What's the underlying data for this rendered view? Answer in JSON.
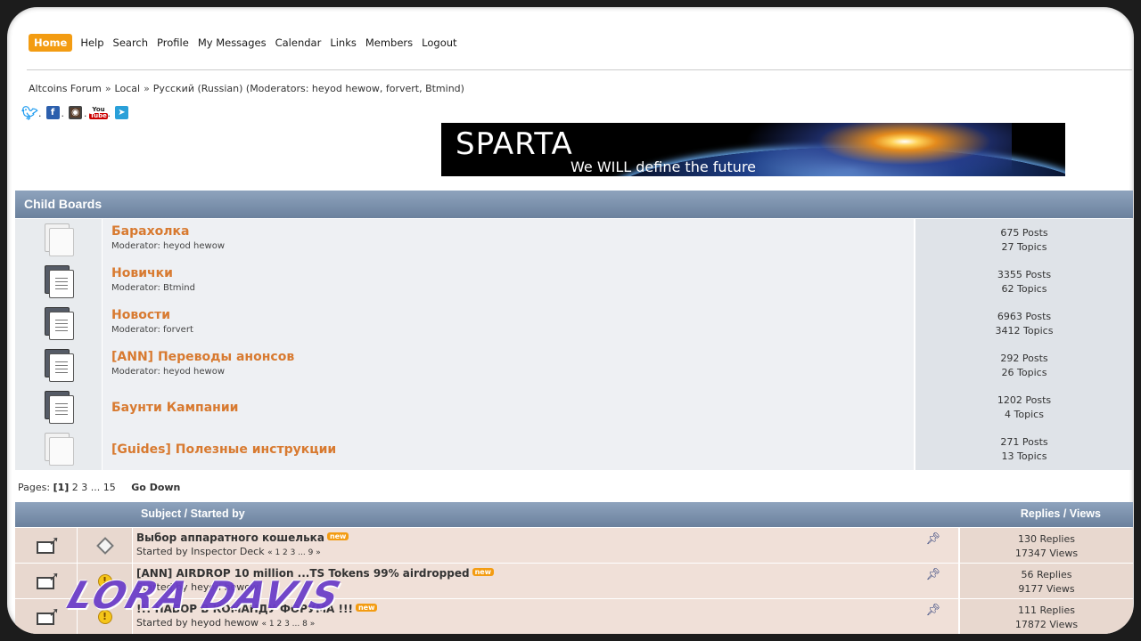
{
  "menu": {
    "items": [
      "Home",
      "Help",
      "Search",
      "Profile",
      "My Messages",
      "Calendar",
      "Links",
      "Members",
      "Logout"
    ],
    "active": "Home"
  },
  "breadcrumb": {
    "items": [
      "Altcoins Forum",
      "Local",
      "Русский (Russian) (Moderators: heyod hewow, forvert, Btmind)"
    ],
    "separator": "»"
  },
  "social": {
    "icons": [
      "twitter-icon",
      "facebook-icon",
      "instagram-icon",
      "youtube-icon",
      "telegram-icon"
    ],
    "separator": "."
  },
  "banner": {
    "title": "SPARTA",
    "tagline": "We WILL define the future"
  },
  "child_boards": {
    "header": "Child Boards",
    "boards": [
      {
        "name": "Барахолка",
        "moderator": "Moderator: heyod hewow",
        "posts": "675 Posts",
        "topics": "27 Topics",
        "state": "off"
      },
      {
        "name": "Новички",
        "moderator": "Moderator: Btmind",
        "posts": "3355 Posts",
        "topics": "62 Topics",
        "state": "on"
      },
      {
        "name": "Новости",
        "moderator": "Moderator: forvert",
        "posts": "6963 Posts",
        "topics": "3412 Topics",
        "state": "on"
      },
      {
        "name": "[ANN] Переводы анонсов",
        "moderator": "Moderator: heyod hewow",
        "posts": "292 Posts",
        "topics": "26 Topics",
        "state": "on"
      },
      {
        "name": "Баунти Кампании",
        "moderator": "",
        "posts": "1202 Posts",
        "topics": "4 Topics",
        "state": "on"
      },
      {
        "name": "[Guides] Полезные инструкции",
        "moderator": "",
        "posts": "271 Posts",
        "topics": "13 Topics",
        "state": "off"
      }
    ]
  },
  "pagination": {
    "label": "Pages:",
    "current": "[1]",
    "others": "2 3 ... 15",
    "go_down": "Go Down"
  },
  "topics": {
    "col_subject": "Subject / Started by",
    "col_replies": "Replies / Views",
    "new_badge": "new",
    "rows": [
      {
        "title": "Выбор аппаратного кошелька",
        "started_by": "Started by Inspector Deck",
        "pages": "« 1 2 3 ... 9 »",
        "replies": "130 Replies",
        "views": "17347 Views",
        "icon": "diamond"
      },
      {
        "title": "[ANN] AIRDROP 10 million ...TS Tokens 99% airdropped",
        "started_by": "Started by heyod hewow",
        "pages": "",
        "replies": "56 Replies",
        "views": "9177 Views",
        "icon": "warning"
      },
      {
        "title": "!!! НАБОР В КОМАНДУ ФОРУМА !!!",
        "started_by": "Started by heyod hewow",
        "pages": "« 1 2 3 ... 8 »",
        "replies": "111 Replies",
        "views": "17872 Views",
        "icon": "warning"
      }
    ]
  },
  "watermark": "LORA DAVIS"
}
